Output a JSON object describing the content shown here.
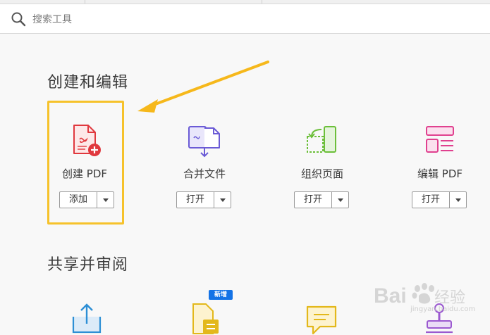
{
  "search": {
    "placeholder": "搜索工具"
  },
  "sections": {
    "create_edit": {
      "title": "创建和编辑"
    },
    "share_review": {
      "title": "共享并审阅"
    }
  },
  "tools": [
    {
      "label": "创建 PDF",
      "button": "添加",
      "icon": "create-pdf-icon",
      "color": "#e0383e"
    },
    {
      "label": "合并文件",
      "button": "打开",
      "icon": "combine-files-icon",
      "color": "#6b5bd6"
    },
    {
      "label": "组织页面",
      "button": "打开",
      "icon": "organize-pages-icon",
      "color": "#6cbf3a"
    },
    {
      "label": "编辑 PDF",
      "button": "打开",
      "icon": "edit-pdf-icon",
      "color": "#e0418f"
    }
  ],
  "share_tools": [
    {
      "icon": "share-icon",
      "color": "#2d8fd5"
    },
    {
      "icon": "new-document-icon",
      "color": "#e3b81b",
      "badge": "新增"
    },
    {
      "icon": "comment-icon",
      "color": "#e3b81b"
    },
    {
      "icon": "stamp-icon",
      "color": "#9b59d0"
    }
  ],
  "annotation": {
    "highlight_color": "#f6c22b",
    "arrow_color": "#f6b81b"
  },
  "watermark": {
    "text": "jingyan.baidu.com"
  }
}
